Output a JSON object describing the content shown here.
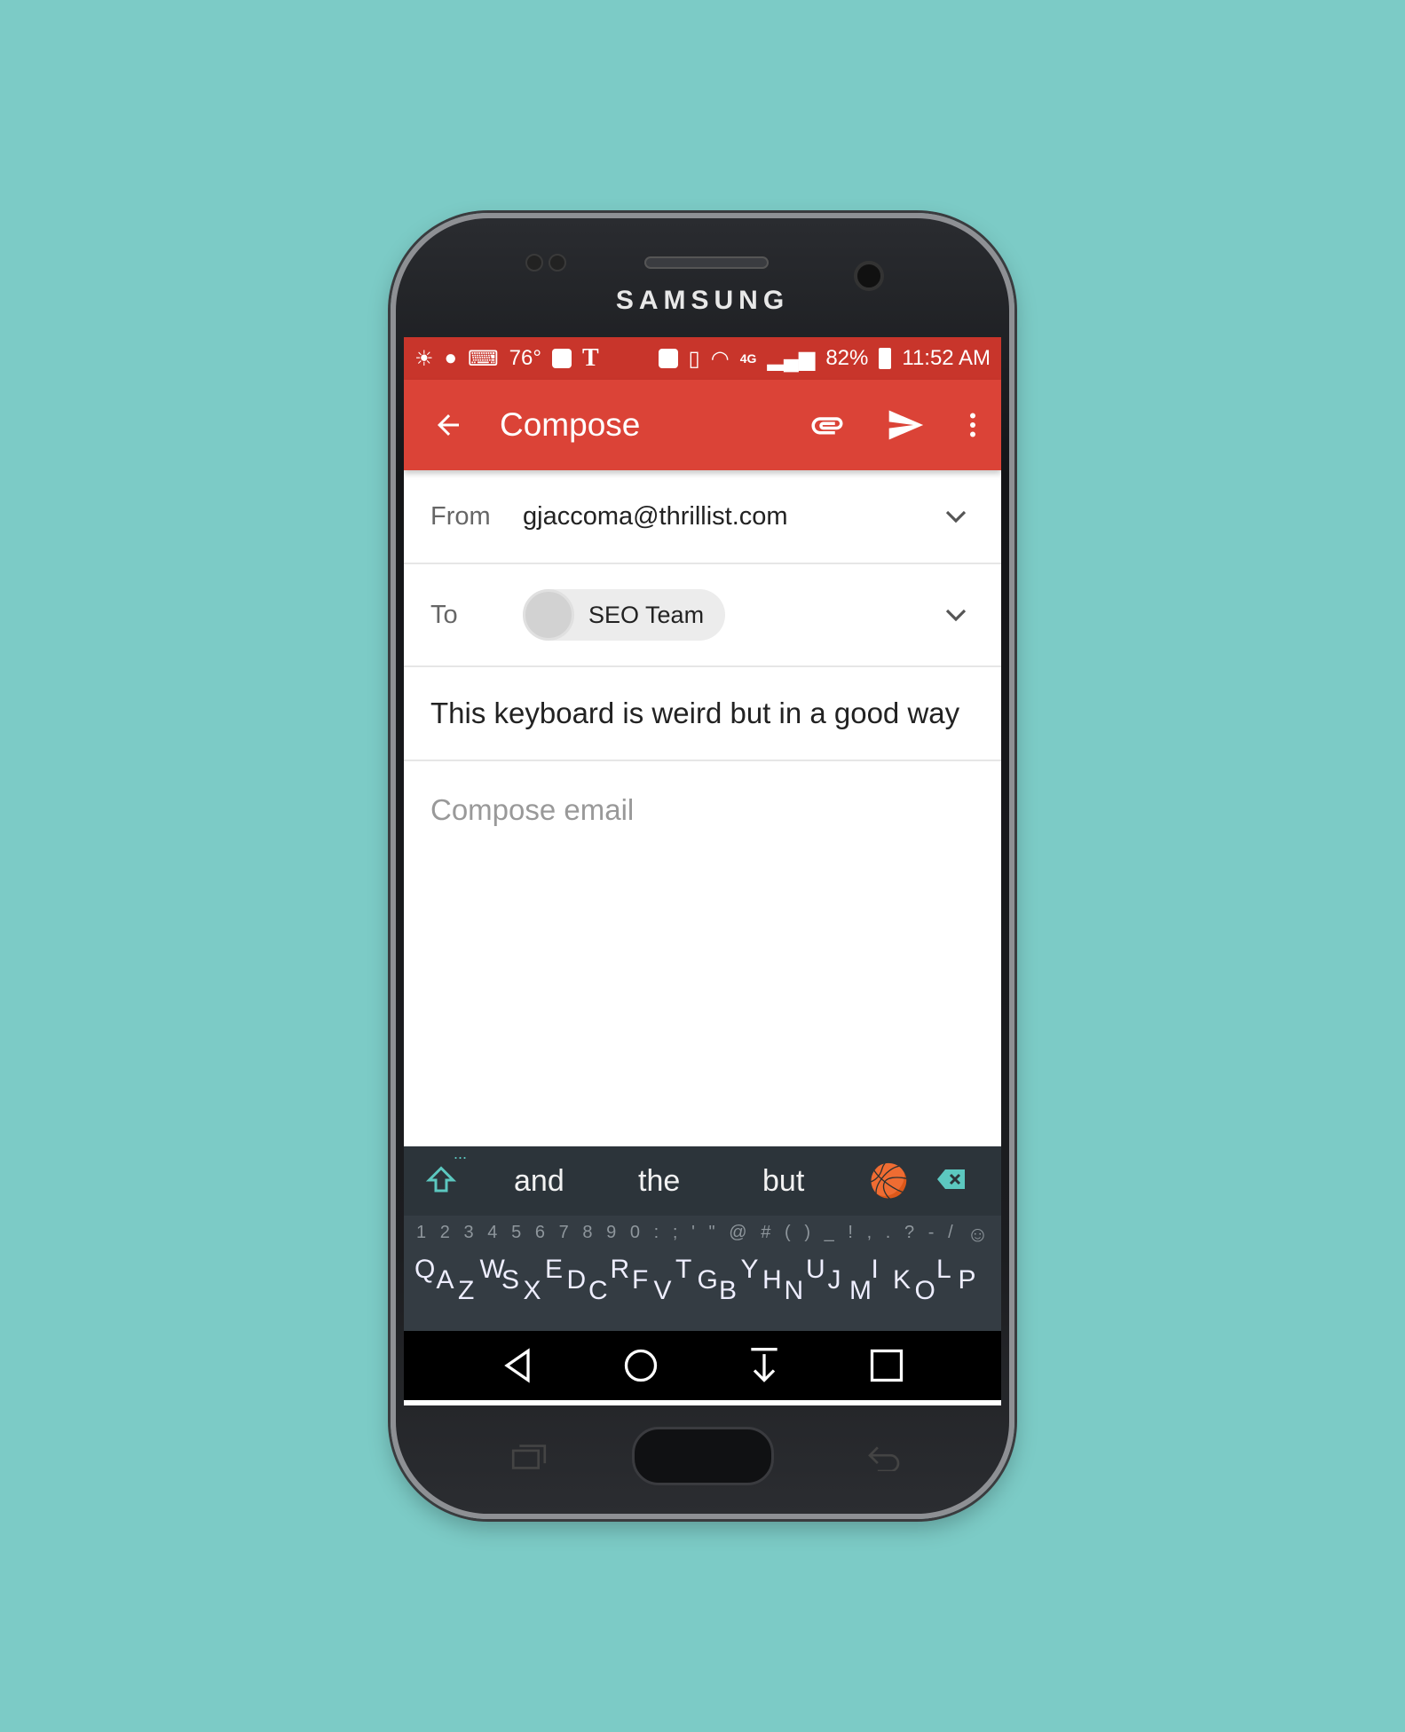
{
  "device": {
    "brand": "SAMSUNG"
  },
  "status_bar": {
    "temperature": "76°",
    "battery": "82%",
    "time": "11:52 AM",
    "network": "4G",
    "icons": [
      "brightness-icon",
      "hangouts-icon",
      "keyboard-icon",
      "image-icon",
      "nytimes-icon",
      "nfc-icon",
      "vibrate-icon",
      "wifi-icon",
      "signal-icon",
      "battery-icon"
    ]
  },
  "toolbar": {
    "title": "Compose",
    "icons": [
      "back-arrow-icon",
      "attach-icon",
      "send-icon",
      "more-vert-icon"
    ]
  },
  "from": {
    "label": "From",
    "value": "gjaccoma@thrillist.com"
  },
  "to": {
    "label": "To",
    "recipient": "SEO Team"
  },
  "subject": {
    "value": "This keyboard is weird but in a good way"
  },
  "body": {
    "placeholder": "Compose email"
  },
  "keyboard": {
    "suggestions": [
      "and",
      "the",
      "but"
    ],
    "emoji_suggestion": "🏀",
    "more": "...",
    "numbers_row": [
      "1",
      "2",
      "3",
      "4",
      "5",
      "6",
      "7",
      "8",
      "9",
      "0",
      ":",
      ";",
      "'",
      "\"",
      "@",
      "#",
      "(",
      ")",
      "_",
      "!",
      ",",
      ".",
      "?",
      "-",
      "/"
    ],
    "letters": [
      "Q",
      "A",
      "Z",
      "W",
      "S",
      "X",
      "E",
      "D",
      "C",
      "R",
      "F",
      "V",
      "T",
      "G",
      "B",
      "Y",
      "H",
      "N",
      "U",
      "J",
      "M",
      "I",
      "K",
      "O",
      "L",
      "P"
    ],
    "accent_color": "#5cc8c0"
  },
  "colors": {
    "toolbar": "#db4337",
    "status_bar": "#c8352b",
    "background": "#7ccbc6"
  }
}
